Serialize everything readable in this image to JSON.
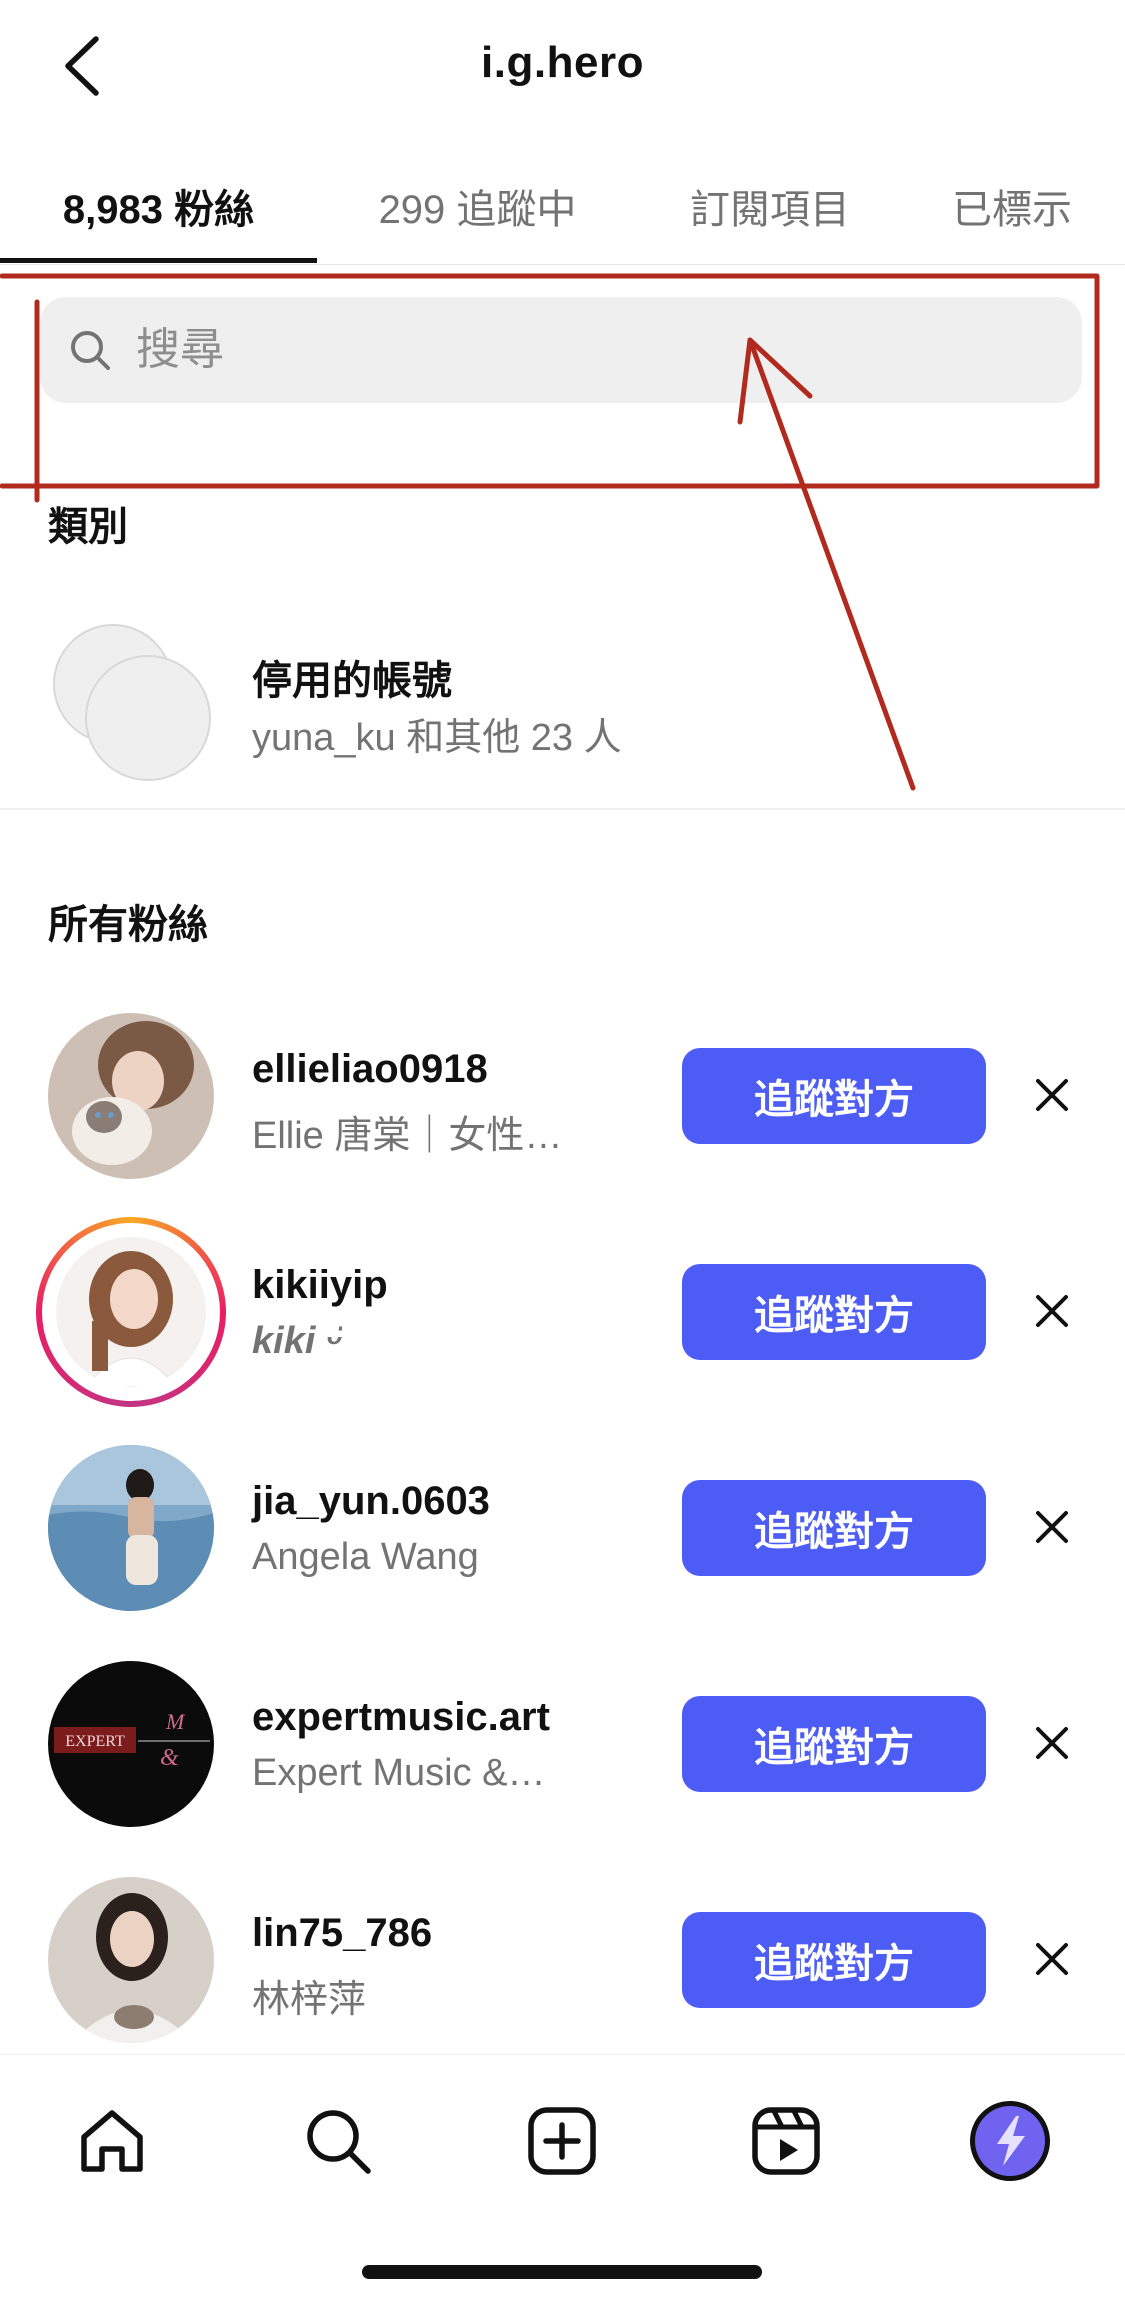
{
  "header": {
    "title": "i.g.hero",
    "back_icon": "chevron-left-icon"
  },
  "tabs": [
    {
      "label": "8,983 粉絲",
      "active": true
    },
    {
      "label": "299 追蹤中",
      "active": false
    },
    {
      "label": "訂閱項目",
      "active": false
    },
    {
      "label": "已標示",
      "active": false
    }
  ],
  "search": {
    "placeholder": "搜尋",
    "icon": "search-icon"
  },
  "categories": {
    "title": "類別",
    "items": [
      {
        "name": "停用的帳號",
        "subtitle": "yuna_ku 和其他 23 人"
      }
    ]
  },
  "followers": {
    "title": "所有粉絲",
    "follow_label": "追蹤對方",
    "items": [
      {
        "username": "ellieliao0918",
        "fullname": "Ellie 唐棠｜女性…",
        "has_story": false
      },
      {
        "username": "kikiiyip",
        "fullname": "kiki ᵕ̈",
        "has_story": true
      },
      {
        "username": "jia_yun.0603",
        "fullname": "Angela Wang",
        "has_story": false
      },
      {
        "username": "expertmusic.art",
        "fullname": "Expert Music &…",
        "has_story": false,
        "avatar_text": "EXPERT"
      },
      {
        "username": "lin75_786",
        "fullname": "林梓萍",
        "has_story": false
      }
    ]
  },
  "bottom_nav": {
    "items": [
      "home-icon",
      "search-icon",
      "create-icon",
      "reels-icon",
      "profile-icon"
    ]
  },
  "colors": {
    "accent": "#4c5cf5",
    "annotation": "#b22a1e",
    "muted_text": "#737373",
    "search_bg": "#efefef"
  }
}
